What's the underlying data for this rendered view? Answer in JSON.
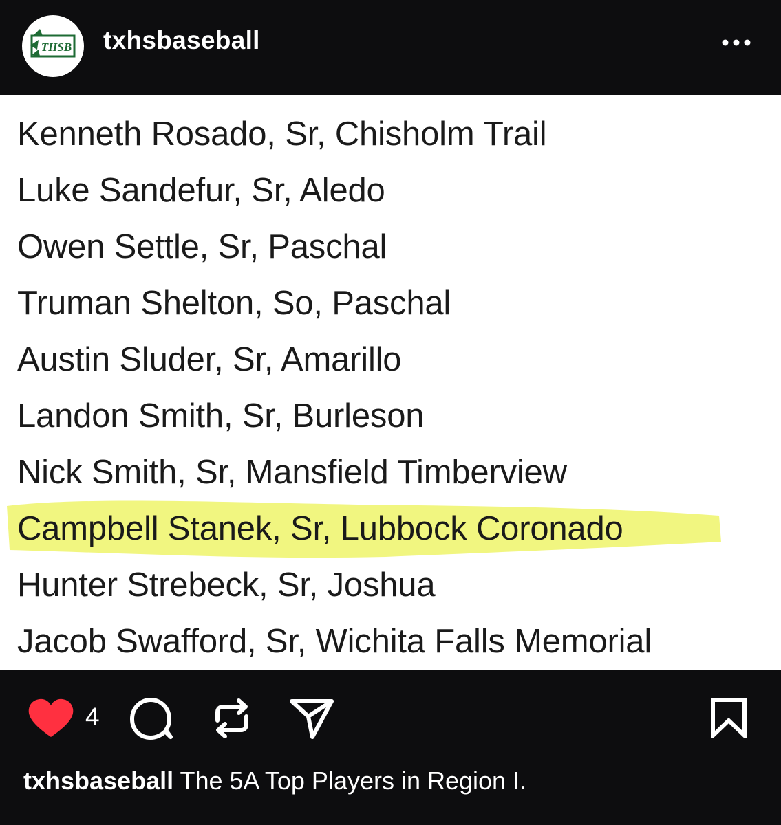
{
  "header": {
    "avatar_logo_text": "THSB",
    "username": "txhsbaseball",
    "more_icon": "more-horizontal-icon"
  },
  "post": {
    "players": [
      "Kenneth Rosado, Sr, Chisholm Trail",
      "Luke Sandefur, Sr, Aledo",
      "Owen Settle, Sr, Paschal",
      "Truman Shelton, So, Paschal",
      "Austin Sluder, Sr, Amarillo",
      "Landon Smith, Sr, Burleson",
      "Nick Smith, Sr, Mansfield Timberview",
      "Campbell Stanek, Sr, Lubbock Coronado",
      "Hunter Strebeck, Sr, Joshua",
      "Jacob Swafford, Sr, Wichita Falls Memorial"
    ],
    "highlighted_index": 7,
    "highlight_color": "#eef56a"
  },
  "actions": {
    "like_count": "4",
    "liked": true,
    "like_color": "#ff3040",
    "icons": [
      "heart-icon",
      "comment-icon",
      "repost-icon",
      "share-icon",
      "bookmark-icon"
    ]
  },
  "caption": {
    "username": "txhsbaseball",
    "text": "The 5A Top Players in Region I."
  }
}
